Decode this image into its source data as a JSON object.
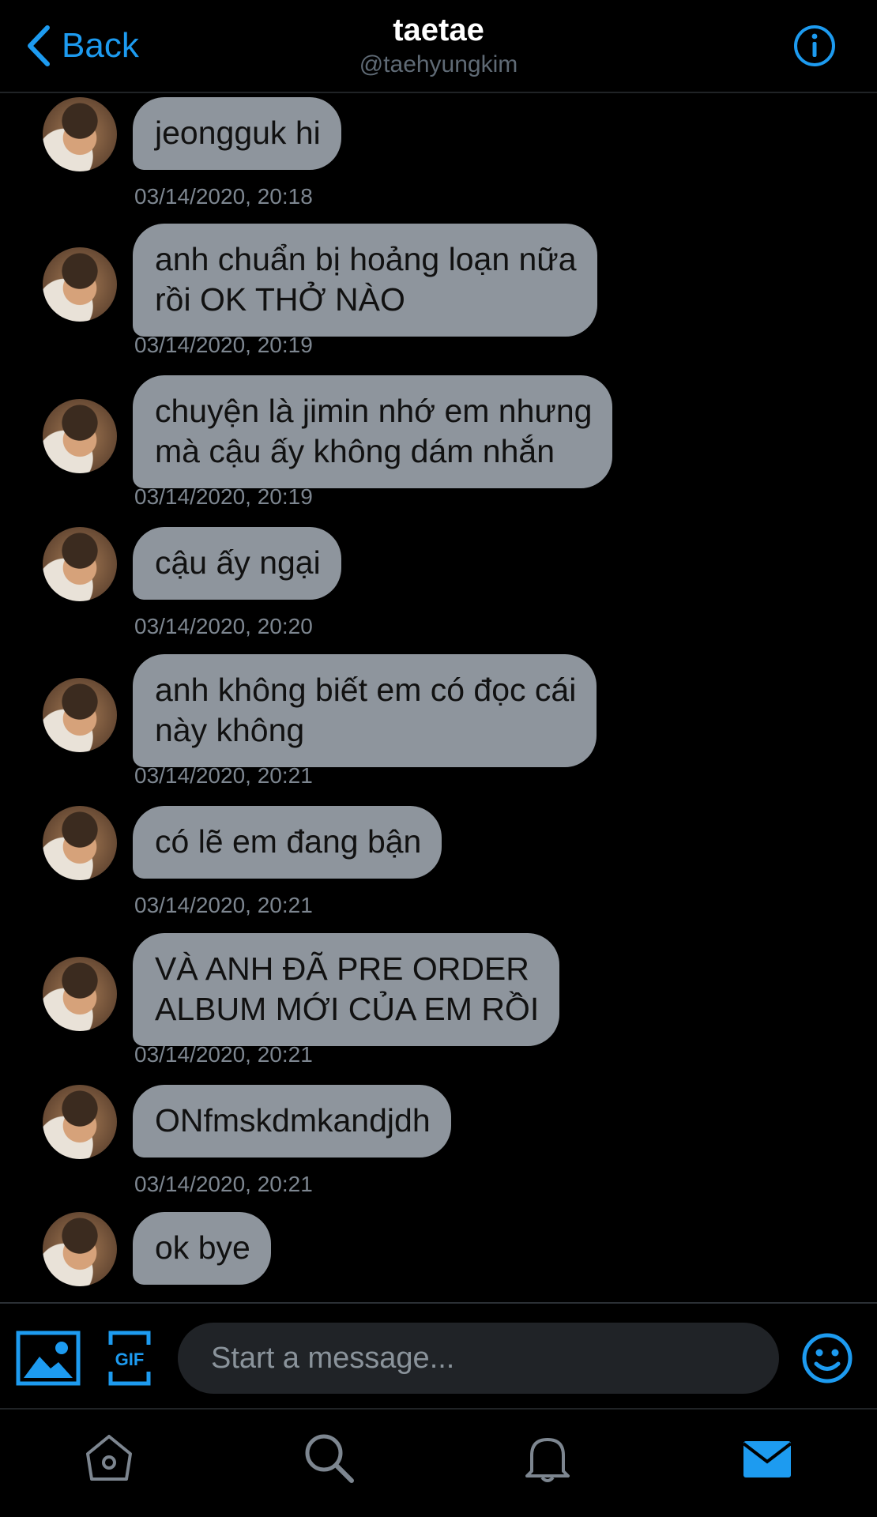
{
  "header": {
    "back_label": "Back",
    "title": "taetae",
    "handle": "@taehyungkim"
  },
  "messages": [
    {
      "text": "jeongguk hi",
      "time": "03/14/2020, 20:18"
    },
    {
      "text": "anh chuẩn bị hoảng loạn nữa\nrồi OK THỞ NÀO",
      "time": "03/14/2020, 20:19"
    },
    {
      "text": "chuyện là jimin nhớ em nhưng\nmà cậu ấy không dám nhắn",
      "time": "03/14/2020, 20:19"
    },
    {
      "text": "cậu ấy ngại",
      "time": "03/14/2020, 20:20"
    },
    {
      "text": "anh không biết em có đọc cái\nnày không",
      "time": "03/14/2020, 20:21"
    },
    {
      "text": "có lẽ em đang bận",
      "time": "03/14/2020, 20:21"
    },
    {
      "text": "VÀ ANH ĐÃ PRE ORDER\nALBUM MỚI CỦA EM RỒI",
      "time": "03/14/2020, 20:21"
    },
    {
      "text": "ONfmskdmkandjdh",
      "time": "03/14/2020, 20:21"
    },
    {
      "text": "ok bye",
      "time": ""
    }
  ],
  "composer": {
    "placeholder": "Start a message..."
  },
  "icons": {
    "back": "chevron-left-icon",
    "info": "info-icon",
    "media": "image-icon",
    "gif": "gif-icon",
    "emoji": "smiley-icon",
    "tabs": [
      "home-icon",
      "search-icon",
      "bell-icon",
      "mail-icon"
    ]
  },
  "colors": {
    "accent": "#1d9bf0",
    "bubble": "#8e959d",
    "background": "#000000"
  }
}
